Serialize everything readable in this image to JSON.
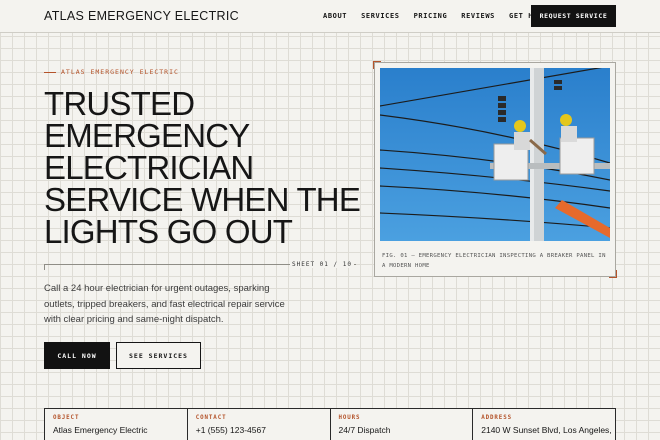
{
  "header": {
    "brand": "ATLAS EMERGENCY ELECTRIC",
    "nav": [
      "ABOUT",
      "SERVICES",
      "PRICING",
      "REVIEWS",
      "GET HELP"
    ],
    "cta": "REQUEST SERVICE"
  },
  "hero": {
    "eyebrow": "ATLAS EMERGENCY ELECTRIC",
    "headline_lines": [
      "TRUSTED",
      "EMERGENCY",
      "ELECTRICIAN",
      "SERVICE WHEN THE",
      "LIGHTS GO OUT"
    ],
    "sheet": "SHEET 01 / 10",
    "description": "Call a 24 hour electrician for urgent outages, sparking outlets, tripped breakers, and fast electrical repair service with clear pricing and same-night dispatch.",
    "primary_button": "CALL NOW",
    "secondary_button": "SEE SERVICES"
  },
  "figure": {
    "caption": "FIG. 01 — EMERGENCY ELECTRICIAN INSPECTING A BREAKER PANEL IN A MODERN HOME"
  },
  "info": [
    {
      "label": "OBJECT",
      "value": "Atlas Emergency Electric"
    },
    {
      "label": "CONTACT",
      "value": "+1 (555) 123-4567"
    },
    {
      "label": "HOURS",
      "value": "24/7 Dispatch"
    },
    {
      "label": "ADDRESS",
      "value": "2140 W Sunset Blvd, Los Angeles,"
    }
  ],
  "colors": {
    "accent": "#b4532a",
    "ink": "#161616",
    "paper": "#f4f3ef"
  }
}
